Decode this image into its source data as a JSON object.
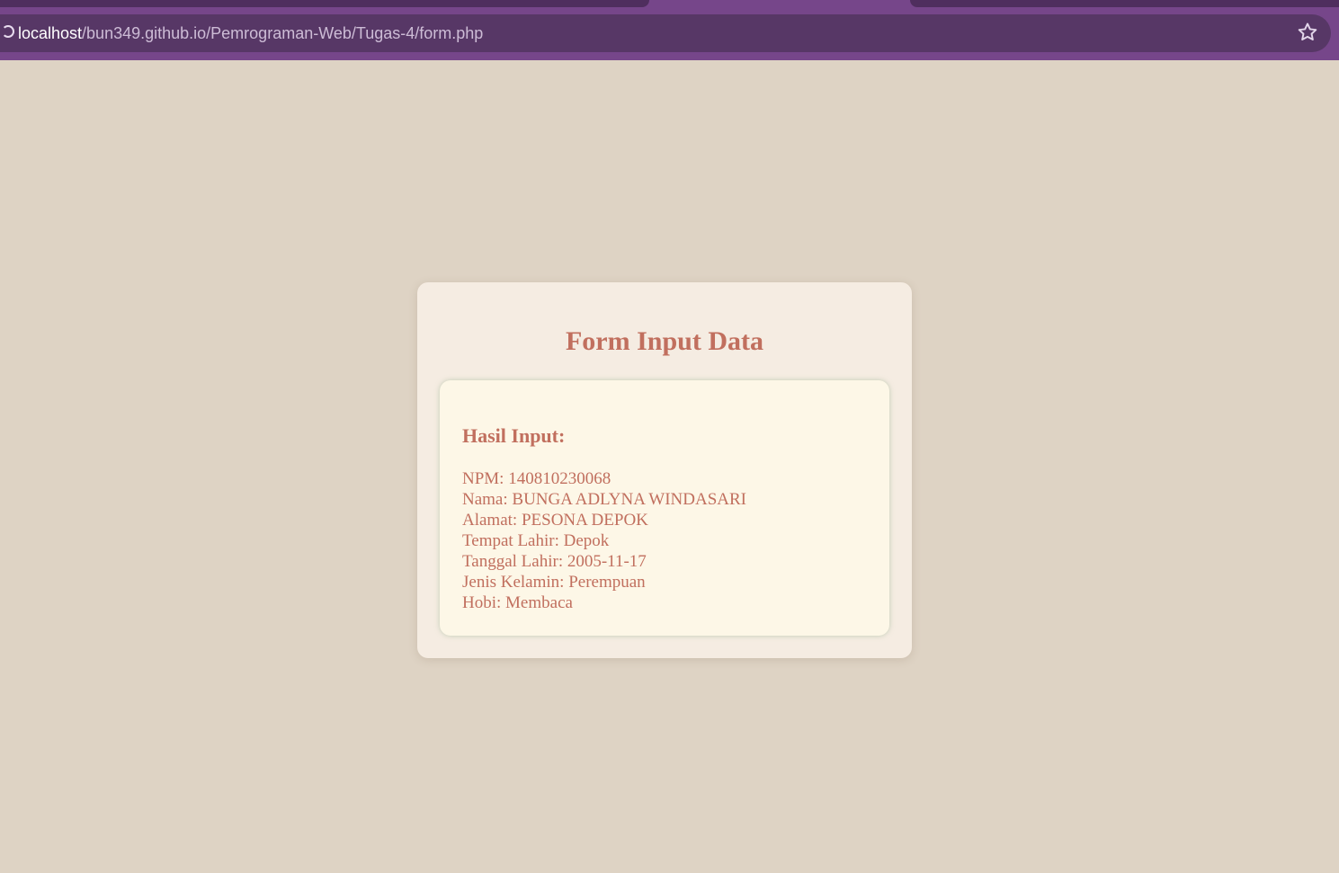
{
  "browser": {
    "url_host": "localhost",
    "url_path": "/bun349.github.io/Pemrograman-Web/Tugas-4/form.php",
    "accent_color": "#76468a"
  },
  "page": {
    "title": "Form Input Data",
    "result_heading": "Hasil Input:",
    "results": [
      "NPM: 140810230068",
      "Nama: BUNGA ADLYNA WINDASARI",
      "Alamat: PESONA DEPOK",
      "Tempat Lahir: Depok",
      "Tanggal Lahir: 2005-11-17",
      "Jenis Kelamin: Perempuan",
      "Hobi: Membaca"
    ],
    "text_color": "#c16f5e",
    "background_color": "#ded3c4"
  }
}
